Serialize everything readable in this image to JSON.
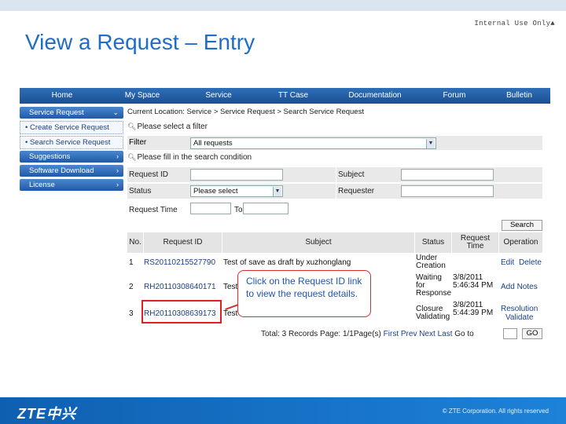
{
  "slide": {
    "internal_label": "Internal Use Only▲",
    "title": "View a Request – Entry",
    "logo": "ZTE中兴",
    "copyright": "© ZTE Corporation. All rights reserved"
  },
  "nav": [
    "Home",
    "My Space",
    "Service",
    "TT Case",
    "Documentation",
    "Forum",
    "Bulletin"
  ],
  "sidebar": {
    "service_request": "Service Request",
    "create": "• Create Service Request",
    "search": "• Search Service Request",
    "suggestions": "Suggestions",
    "software_download": "Software Download",
    "license": "License",
    "chev_down": "⌄",
    "chev_right": "›"
  },
  "breadcrumb": "Current Location: Service > Service Request > Search Service Request",
  "filter": {
    "heading": "Please select a filter",
    "label": "Filter",
    "value": "All requests"
  },
  "condition": {
    "heading": "Please fill in the search condition",
    "request_id_label": "Request ID",
    "subject_label": "Subject",
    "status_label": "Status",
    "status_value": "Please select",
    "requester_label": "Requester",
    "request_time_label": "Request Time",
    "to_label": "To",
    "search_button": "Search"
  },
  "table": {
    "headers": [
      "No.",
      "Request ID",
      "Subject",
      "Status",
      "Request Time",
      "Operation"
    ],
    "rows": [
      {
        "no": "1",
        "id": "RS20110215527790",
        "subject": "Test of save as draft by xuzhonglang",
        "status": "Under Creation",
        "time": "",
        "op1": "Edit",
        "op2": "Delete"
      },
      {
        "no": "2",
        "id": "RH20110308640171",
        "subject": "Test",
        "status": "Waiting for Response",
        "time": "3/8/2011 5:46:34 PM",
        "op1": "Add Notes",
        "op2": ""
      },
      {
        "no": "3",
        "id": "RH20110308639173",
        "subject": "Test",
        "status": "Closure Validating",
        "time": "3/8/2011 5:44:39 PM",
        "op1": "Resolution",
        "op2": "Validate"
      }
    ]
  },
  "pager": {
    "summary": "Total: 3 Records  Page: 1/1Page(s)",
    "first": "First",
    "prev": "Prev",
    "next": "Next",
    "last": "Last",
    "goto": "Go to",
    "go_button": "GO"
  },
  "callout": "Click on the Request ID link to view the request details."
}
